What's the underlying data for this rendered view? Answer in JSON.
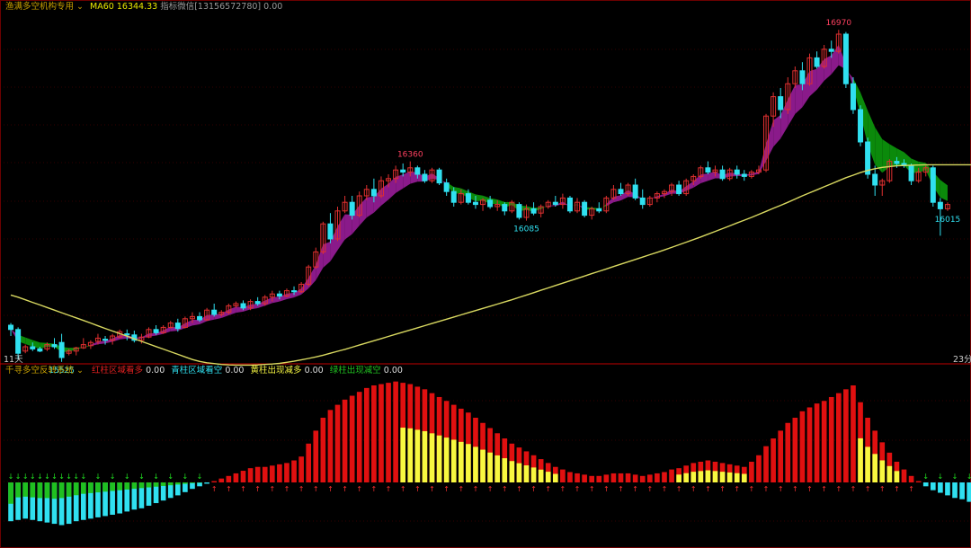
{
  "header_main": {
    "indicator_name": "渔满多空机构专用",
    "ma_label": "MA60 16344.33",
    "aux_label": "指标微信[13156572780] 0.00"
  },
  "header_sub": {
    "indicator_name": "千寻多空反转系统",
    "red_label": "红柱区域看多",
    "red_value": "0.00",
    "cyan_label": "青柱区域看空",
    "cyan_value": "0.00",
    "yellow_label": "黄柱出现减多",
    "yellow_value": "0.00",
    "green_label": "绿柱出现减空",
    "green_value": "0.00"
  },
  "axis_labels": {
    "left_bottom": "11天",
    "right_bottom": "23分"
  },
  "colors": {
    "background": "#000000",
    "ma_line": "#d8d860",
    "band_up": "#8a1a8a",
    "band_down": "#0b8a0b",
    "candle_up": "#e03030",
    "candle_down": "#30e0f0",
    "bar_red": "#e01010",
    "bar_yellow": "#f8f840",
    "bar_green": "#20c020",
    "bar_cyan": "#30e0f0",
    "grid": "#6b0000"
  },
  "chart_data": [
    {
      "type": "candlestick",
      "title": "渔满多空机构专用",
      "annotations": [
        {
          "text": "15525",
          "x_index": 7,
          "kind": "low"
        },
        {
          "text": "16360",
          "x_index": 55,
          "kind": "high"
        },
        {
          "text": "16085",
          "x_index": 71,
          "kind": "low"
        },
        {
          "text": "16970",
          "x_index": 114,
          "kind": "high"
        },
        {
          "text": "16015",
          "x_index": 129,
          "kind": "low"
        }
      ],
      "ylim": [
        15450,
        17050
      ],
      "series": [
        {
          "name": "MA60",
          "values": [
            15740,
            15730,
            15718,
            15706,
            15694,
            15682,
            15670,
            15658,
            15646,
            15634,
            15622,
            15610,
            15597,
            15585,
            15573,
            15561,
            15549,
            15537,
            15525,
            15513,
            15501,
            15489,
            15477,
            15465,
            15453,
            15441,
            15432,
            15426,
            15422,
            15418,
            15416,
            15415,
            15415,
            15415,
            15416,
            15418,
            15420,
            15423,
            15428,
            15433,
            15439,
            15446,
            15453,
            15461,
            15470,
            15479,
            15488,
            15498,
            15508,
            15518,
            15528,
            15538,
            15548,
            15558,
            15568,
            15578,
            15588,
            15598,
            15608,
            15618,
            15628,
            15638,
            15648,
            15658,
            15668,
            15678,
            15688,
            15698,
            15708,
            15718,
            15729,
            15740,
            15751,
            15762,
            15773,
            15784,
            15795,
            15806,
            15817,
            15828,
            15839,
            15850,
            15861,
            15872,
            15883,
            15894,
            15905,
            15916,
            15927,
            15938,
            15949,
            15961,
            15973,
            15985,
            15997,
            16009,
            16022,
            16035,
            16048,
            16061,
            16074,
            16087,
            16100,
            16114,
            16128,
            16142,
            16156,
            16170,
            16185,
            16200,
            16214,
            16228,
            16242,
            16256,
            16270,
            16284,
            16296,
            16308,
            16318,
            16326,
            16332,
            16336,
            16339,
            16341,
            16342,
            16343,
            16344,
            16344,
            16344,
            16344,
            16344,
            16344,
            16344,
            16344
          ]
        },
        {
          "name": "band",
          "values": []
        }
      ],
      "candles": [
        [
          15600,
          15610,
          15550,
          15580
        ],
        [
          15580,
          15590,
          15440,
          15470
        ],
        [
          15480,
          15510,
          15470,
          15500
        ],
        [
          15500,
          15520,
          15480,
          15490
        ],
        [
          15490,
          15500,
          15475,
          15480
        ],
        [
          15490,
          15520,
          15480,
          15510
        ],
        [
          15510,
          15540,
          15490,
          15500
        ],
        [
          15520,
          15560,
          15430,
          15450
        ],
        [
          15470,
          15490,
          15460,
          15480
        ],
        [
          15480,
          15500,
          15460,
          15495
        ],
        [
          15495,
          15540,
          15490,
          15510
        ],
        [
          15505,
          15530,
          15490,
          15520
        ],
        [
          15525,
          15560,
          15510,
          15540
        ],
        [
          15535,
          15550,
          15510,
          15530
        ],
        [
          15530,
          15560,
          15510,
          15550
        ],
        [
          15545,
          15580,
          15540,
          15570
        ],
        [
          15560,
          15580,
          15530,
          15555
        ],
        [
          15555,
          15575,
          15520,
          15530
        ],
        [
          15530,
          15560,
          15515,
          15545
        ],
        [
          15545,
          15590,
          15540,
          15580
        ],
        [
          15580,
          15600,
          15555,
          15565
        ],
        [
          15565,
          15600,
          15560,
          15590
        ],
        [
          15590,
          15620,
          15585,
          15610
        ],
        [
          15610,
          15630,
          15570,
          15585
        ],
        [
          15590,
          15640,
          15585,
          15630
        ],
        [
          15630,
          15660,
          15610,
          15640
        ],
        [
          15640,
          15660,
          15615,
          15625
        ],
        [
          15625,
          15680,
          15620,
          15670
        ],
        [
          15670,
          15700,
          15640,
          15650
        ],
        [
          15650,
          15670,
          15640,
          15660
        ],
        [
          15660,
          15700,
          15650,
          15690
        ],
        [
          15690,
          15710,
          15680,
          15700
        ],
        [
          15700,
          15715,
          15670,
          15680
        ],
        [
          15680,
          15720,
          15670,
          15710
        ],
        [
          15710,
          15730,
          15690,
          15700
        ],
        [
          15700,
          15740,
          15690,
          15730
        ],
        [
          15730,
          15760,
          15710,
          15745
        ],
        [
          15745,
          15760,
          15720,
          15735
        ],
        [
          15735,
          15770,
          15730,
          15760
        ],
        [
          15760,
          15780,
          15740,
          15755
        ],
        [
          15755,
          15800,
          15750,
          15790
        ],
        [
          15790,
          15880,
          15780,
          15870
        ],
        [
          15870,
          15960,
          15860,
          15940
        ],
        [
          15940,
          16080,
          15930,
          16070
        ],
        [
          16070,
          16120,
          15980,
          16000
        ],
        [
          16000,
          16150,
          15990,
          16130
        ],
        [
          16130,
          16200,
          16120,
          16170
        ],
        [
          16170,
          16200,
          16090,
          16110
        ],
        [
          16110,
          16220,
          16100,
          16200
        ],
        [
          16200,
          16250,
          16180,
          16230
        ],
        [
          16230,
          16280,
          16170,
          16200
        ],
        [
          16200,
          16290,
          16190,
          16270
        ],
        [
          16270,
          16300,
          16240,
          16280
        ],
        [
          16280,
          16340,
          16260,
          16320
        ],
        [
          16320,
          16350,
          16290,
          16310
        ],
        [
          16310,
          16360,
          16290,
          16330
        ],
        [
          16330,
          16340,
          16280,
          16300
        ],
        [
          16300,
          16320,
          16260,
          16270
        ],
        [
          16270,
          16330,
          16260,
          16320
        ],
        [
          16320,
          16330,
          16250,
          16260
        ],
        [
          16260,
          16280,
          16200,
          16220
        ],
        [
          16220,
          16240,
          16150,
          16170
        ],
        [
          16170,
          16230,
          16160,
          16210
        ],
        [
          16210,
          16230,
          16160,
          16170
        ],
        [
          16170,
          16200,
          16140,
          16160
        ],
        [
          16160,
          16190,
          16130,
          16180
        ],
        [
          16180,
          16200,
          16140,
          16150
        ],
        [
          16150,
          16180,
          16130,
          16160
        ],
        [
          16160,
          16170,
          16110,
          16130
        ],
        [
          16130,
          16180,
          16120,
          16170
        ],
        [
          16160,
          16170,
          16090,
          16100
        ],
        [
          16100,
          16160,
          16085,
          16140
        ],
        [
          16140,
          16170,
          16110,
          16120
        ],
        [
          16120,
          16160,
          16100,
          16150
        ],
        [
          16150,
          16180,
          16140,
          16170
        ],
        [
          16170,
          16200,
          16150,
          16160
        ],
        [
          16160,
          16210,
          16140,
          16190
        ],
        [
          16190,
          16200,
          16120,
          16130
        ],
        [
          16130,
          16190,
          16120,
          16170
        ],
        [
          16170,
          16180,
          16100,
          16110
        ],
        [
          16110,
          16150,
          16090,
          16140
        ],
        [
          16140,
          16170,
          16120,
          16130
        ],
        [
          16130,
          16200,
          16120,
          16190
        ],
        [
          16190,
          16250,
          16180,
          16230
        ],
        [
          16230,
          16260,
          16200,
          16210
        ],
        [
          16210,
          16260,
          16200,
          16250
        ],
        [
          16250,
          16280,
          16180,
          16190
        ],
        [
          16190,
          16230,
          16140,
          16160
        ],
        [
          16160,
          16200,
          16150,
          16190
        ],
        [
          16190,
          16220,
          16170,
          16210
        ],
        [
          16210,
          16230,
          16190,
          16220
        ],
        [
          16220,
          16260,
          16200,
          16250
        ],
        [
          16250,
          16270,
          16200,
          16210
        ],
        [
          16210,
          16280,
          16200,
          16270
        ],
        [
          16270,
          16300,
          16250,
          16290
        ],
        [
          16290,
          16340,
          16280,
          16330
        ],
        [
          16330,
          16360,
          16300,
          16310
        ],
        [
          16310,
          16340,
          16290,
          16320
        ],
        [
          16320,
          16340,
          16270,
          16280
        ],
        [
          16280,
          16330,
          16270,
          16320
        ],
        [
          16320,
          16340,
          16280,
          16300
        ],
        [
          16300,
          16320,
          16270,
          16290
        ],
        [
          16290,
          16320,
          16280,
          16310
        ],
        [
          16310,
          16340,
          16300,
          16320
        ],
        [
          16320,
          16580,
          16310,
          16570
        ],
        [
          16570,
          16680,
          16520,
          16660
        ],
        [
          16660,
          16700,
          16560,
          16600
        ],
        [
          16600,
          16750,
          16580,
          16720
        ],
        [
          16720,
          16800,
          16700,
          16780
        ],
        [
          16780,
          16820,
          16690,
          16720
        ],
        [
          16720,
          16860,
          16710,
          16840
        ],
        [
          16840,
          16870,
          16790,
          16800
        ],
        [
          16800,
          16900,
          16790,
          16880
        ],
        [
          16880,
          16920,
          16840,
          16870
        ],
        [
          16870,
          16970,
          16860,
          16950
        ],
        [
          16950,
          16960,
          16700,
          16720
        ],
        [
          16720,
          16750,
          16580,
          16600
        ],
        [
          16600,
          16620,
          16430,
          16450
        ],
        [
          16450,
          16470,
          16280,
          16300
        ],
        [
          16300,
          16340,
          16200,
          16250
        ],
        [
          16250,
          16280,
          16200,
          16270
        ],
        [
          16270,
          16370,
          16260,
          16360
        ],
        [
          16360,
          16380,
          16330,
          16350
        ],
        [
          16350,
          16370,
          16330,
          16340
        ],
        [
          16340,
          16350,
          16250,
          16270
        ],
        [
          16270,
          16330,
          16260,
          16310
        ],
        [
          16310,
          16340,
          16290,
          16330
        ],
        [
          16330,
          16340,
          16150,
          16170
        ],
        [
          16170,
          16190,
          16015,
          16140
        ],
        [
          16140,
          16170,
          16130,
          16160
        ]
      ]
    },
    {
      "type": "bar",
      "title": "千寻多空反转系统",
      "values_note": "",
      "main": [
        -60,
        -58,
        -56,
        -58,
        -60,
        -62,
        -64,
        -66,
        -64,
        -60,
        -58,
        -56,
        -54,
        -52,
        -50,
        -48,
        -45,
        -42,
        -40,
        -36,
        -32,
        -28,
        -24,
        -20,
        -15,
        -10,
        -6,
        -2,
        2,
        6,
        10,
        14,
        18,
        22,
        24,
        24,
        26,
        28,
        30,
        34,
        40,
        60,
        80,
        100,
        112,
        120,
        128,
        134,
        140,
        146,
        150,
        152,
        154,
        156,
        154,
        152,
        148,
        144,
        138,
        132,
        126,
        120,
        114,
        108,
        100,
        92,
        84,
        76,
        68,
        60,
        54,
        48,
        42,
        36,
        30,
        24,
        20,
        16,
        14,
        12,
        10,
        10,
        12,
        14,
        14,
        14,
        12,
        10,
        12,
        14,
        16,
        20,
        22,
        26,
        30,
        32,
        34,
        32,
        30,
        28,
        26,
        24,
        32,
        42,
        56,
        68,
        80,
        92,
        100,
        110,
        116,
        122,
        126,
        132,
        138,
        144,
        150,
        124,
        100,
        80,
        62,
        46,
        32,
        20,
        10,
        2,
        -6,
        -12,
        -16,
        -20,
        -24,
        -26,
        -30,
        -40
      ],
      "sub": [
        -60,
        -42,
        -40,
        -42,
        -44,
        -44,
        -46,
        -44,
        -40,
        -36,
        -32,
        -30,
        -28,
        -26,
        -24,
        -22,
        -20,
        -18,
        -16,
        -14,
        -12,
        -10,
        -8,
        -6,
        -4,
        -2,
        -1,
        0,
        0,
        0,
        0,
        0,
        0,
        0,
        0,
        0,
        0,
        0,
        0,
        0,
        0,
        0,
        0,
        0,
        0,
        0,
        0,
        0,
        0,
        0,
        0,
        0,
        0,
        0,
        0,
        0,
        0,
        0,
        0,
        0,
        0,
        0,
        0,
        0,
        0,
        0,
        0,
        0,
        0,
        0,
        0,
        0,
        0,
        0,
        0,
        0,
        0,
        0,
        0,
        0,
        0,
        0,
        0,
        0,
        0,
        0,
        0,
        0,
        0,
        0,
        0,
        0,
        0,
        0,
        0,
        0,
        0,
        0,
        0,
        0,
        0,
        0,
        0,
        0,
        0,
        0,
        0,
        0,
        0,
        0,
        0,
        0,
        0,
        0,
        0,
        0,
        0,
        0,
        0,
        0,
        0,
        0,
        0,
        0,
        0,
        0,
        0,
        0,
        0,
        0,
        0,
        0,
        0,
        0,
        0,
        0
      ]
    }
  ]
}
